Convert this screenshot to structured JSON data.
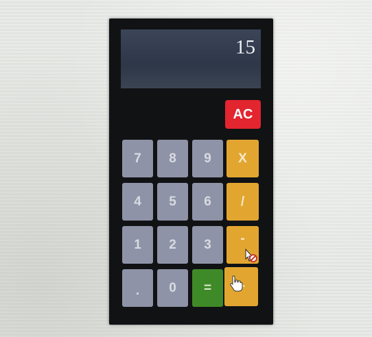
{
  "display": {
    "value": "15"
  },
  "buttons": {
    "clear": "AC",
    "seven": "7",
    "eight": "8",
    "nine": "9",
    "multiply": "X",
    "four": "4",
    "five": "5",
    "six": "6",
    "divide": "/",
    "one": "1",
    "two": "2",
    "three": "3",
    "subtract": "-",
    "decimal": ".",
    "zero": "0",
    "equals": "=",
    "add": "+"
  },
  "colors": {
    "body": "#111214",
    "display": "#2e3748",
    "clear": "#e2252f",
    "number": "#8f93a7",
    "operator": "#e2a630",
    "equals": "#3f8a28"
  },
  "cursors": [
    "no-drop-cursor",
    "hand-pointer-cursor"
  ]
}
